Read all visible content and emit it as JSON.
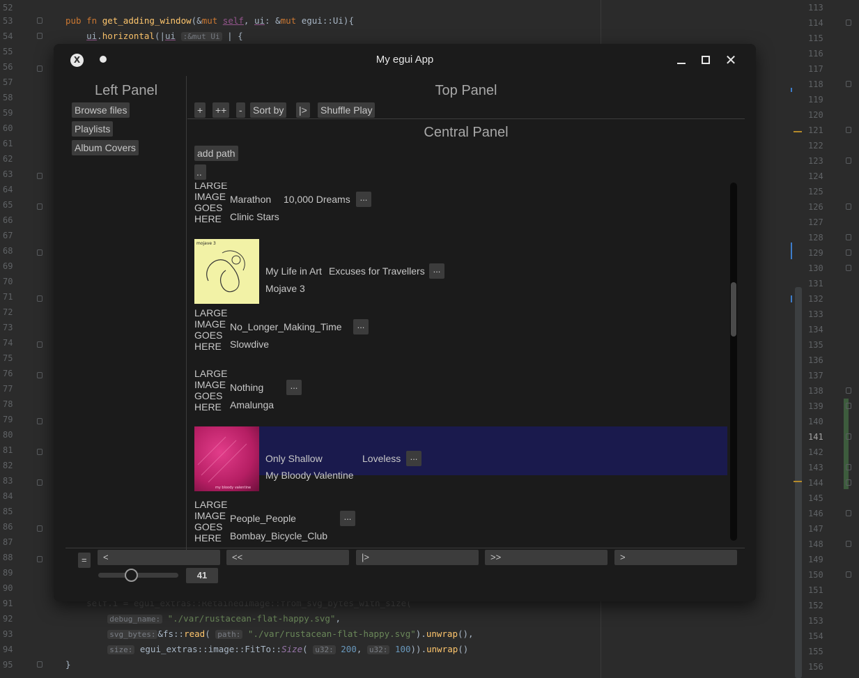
{
  "ide": {
    "lines": [
      {
        "n": "52",
        "code": ""
      },
      {
        "n": "53",
        "code": "pub fn get_adding_window(&mut self, ui: &mut egui::Ui){"
      },
      {
        "n": "54",
        "code": "    ui.horizontal(|ui :&mut Ui | {"
      },
      {
        "n": "55",
        "code": ""
      },
      {
        "n": "56",
        "code": ""
      },
      {
        "n": "91",
        "code": "    self.i = egui_extras::RetainedImage::from_svg_bytes_with_size("
      },
      {
        "n": "92",
        "code": "        debug_name: \"./var/rustacean-flat-happy.svg\","
      },
      {
        "n": "93",
        "code": "        svg_bytes: &fs::read( path: \"./var/rustacean-flat-happy.svg\").unwrap(),"
      },
      {
        "n": "94",
        "code": "        size: egui_extras::image::FitTo::Size( u32: 200, u32: 100)).unwrap()"
      },
      {
        "n": "95",
        "code": "}"
      }
    ],
    "left_line_numbers": [
      "52",
      "53",
      "54",
      "55",
      "56",
      "57",
      "58",
      "59",
      "60",
      "61",
      "62",
      "63",
      "64",
      "65",
      "66",
      "67",
      "68",
      "69",
      "70",
      "71",
      "72",
      "73",
      "74",
      "75",
      "76",
      "77",
      "78",
      "79",
      "80",
      "81",
      "82",
      "83",
      "84",
      "85",
      "86",
      "87",
      "88",
      "89",
      "90",
      "91",
      "92",
      "93",
      "94",
      "95"
    ],
    "right_line_numbers": [
      "113",
      "114",
      "115",
      "116",
      "117",
      "118",
      "119",
      "120",
      "121",
      "122",
      "123",
      "124",
      "125",
      "126",
      "127",
      "128",
      "129",
      "130",
      "131",
      "132",
      "133",
      "134",
      "135",
      "136",
      "137",
      "138",
      "139",
      "140",
      "141",
      "142",
      "143",
      "144",
      "145",
      "146",
      "147",
      "148",
      "149",
      "150",
      "151",
      "152",
      "153",
      "154",
      "155",
      "156"
    ],
    "current_line": "141"
  },
  "window": {
    "title": "My egui App",
    "app_icon": "x-app-icon",
    "minimize_icon": "minimize-icon",
    "maximize_icon": "maximize-icon",
    "close_icon": "close-icon"
  },
  "left_panel": {
    "title": "Left Panel",
    "buttons": [
      "Browse files",
      "Playlists",
      "Album Covers"
    ]
  },
  "top_panel": {
    "title": "Top Panel",
    "buttons": [
      "+",
      "++",
      "-",
      "Sort by",
      "|>",
      "Shuffle Play"
    ]
  },
  "central_panel": {
    "title": "Central Panel",
    "add_path_label": "add path",
    "up_label": "..",
    "placeholder_text": "LARGE\nIMAGE\nGOES\nHERE",
    "more_label": "...",
    "rows": [
      {
        "title": "Marathon",
        "album": "10,000 Dreams",
        "artist": "Clinic Stars",
        "cover": "placeholder",
        "selected": false
      },
      {
        "title": "My Life in Art",
        "album": "Excuses for Travellers",
        "artist": "Mojave 3",
        "cover": "yellow-album-art",
        "selected": false
      },
      {
        "title": "No_Longer_Making_Time",
        "album": "",
        "artist": "Slowdive",
        "cover": "placeholder",
        "selected": false
      },
      {
        "title": "Nothing",
        "album": "",
        "artist": "Amalunga",
        "cover": "placeholder",
        "selected": false
      },
      {
        "title": "Only Shallow",
        "album": "Loveless",
        "artist": "My Bloody Valentine",
        "cover": "pink-album-art",
        "selected": true
      },
      {
        "title": "People_People",
        "album": "",
        "artist": "Bombay_Bicycle_Club",
        "cover": "placeholder",
        "selected": false
      }
    ],
    "selected_color": "#1a1a4d"
  },
  "bottom_panel": {
    "menu_label": "=",
    "controls": [
      "<",
      "<<",
      "|>",
      ">>",
      ">"
    ],
    "volume_value": "41",
    "volume_fraction": 0.41
  }
}
